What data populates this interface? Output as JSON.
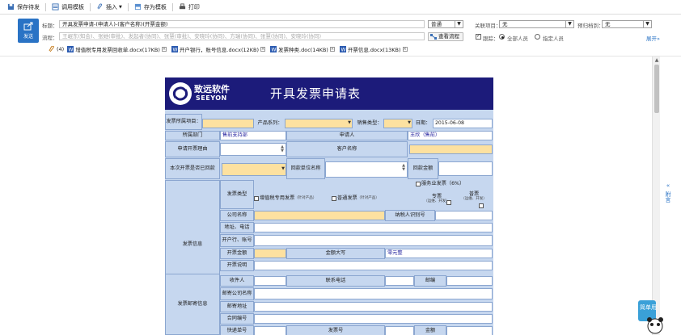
{
  "toolbar": {
    "save_pending": "保存待发",
    "use_template": "调用模板",
    "insert": "插入",
    "save_template": "存为模板",
    "print": "打印"
  },
  "header": {
    "send_label": "发送",
    "subject_label": "标题：",
    "subject_value": "开具发票申请-(申请人)-(客户名称)(开票金额)",
    "importance_value": "普通",
    "related_project_label": "关联项目：",
    "related_project_value": "无",
    "due_remind_label": "预归档到：",
    "due_remind_value": "无",
    "flow_label": "流程：",
    "flow_value": "王岷东(知会)、张她(审批)、发起者(协同)、张慧(审批)、安晓玲(协同)、方瑞(协同)、张慧(协同)、安晓玲(协同)",
    "view_flow": "查看流程",
    "trace_label": "跟踪：",
    "all_people": "全部人员",
    "specified_people": "指定人员",
    "expand": "展开"
  },
  "attachments": {
    "count": "(4)",
    "items": [
      "增值税专用发票回收单.docx(17KB)",
      "开户银行，账号信息.docx(12KB)",
      "发票种类.doc(14KB)",
      "开票信息.docx(13KB)"
    ]
  },
  "side_panel": {
    "label": "附言"
  },
  "mascot": {
    "text": "简单用"
  },
  "form": {
    "logo_cn": "致远软件",
    "logo_en": "SEEYON",
    "title": "开具发票申请表",
    "invoice_item": "发票所属项目：",
    "product_series": "产品系列：",
    "sales_type": "销售类型：",
    "date_label": "日期：",
    "date_value": "2015-06-08",
    "dept_label": "所属部门",
    "dept_value": "售前支持部",
    "applicant_label": "申请人",
    "applicant_value": "王欣（售前）",
    "reason_label": "申请开票理由",
    "customer_label": "客户名称",
    "is_return_label": "本次开票是否已回款",
    "payer_label": "回款单位名称",
    "return_amount_label": "回款金额",
    "service_invoice": "服务业发票（6%）",
    "invoice_type_label": "发票类型",
    "vat_special": "增值税专用发票",
    "vat_special_note": "（针对产品）",
    "vat_normal": "普通发票",
    "vat_normal_note": "（针对产品）",
    "special_label": "专票",
    "special_note": "（运维、开发）",
    "normal_label": "普票",
    "normal_note": "（运维、开发）",
    "invoice_info_label": "发票信息",
    "company_name": "公司名称",
    "taxpayer_id": "纳税人识别号",
    "address_phone": "地址、电话",
    "bank_account": "开户行、账号",
    "invoice_amount": "开票金额",
    "amount_caps": "金额大写",
    "amount_caps_value": "零元整",
    "invoice_note": "开票说明",
    "mail_info_label": "发票邮寄信息",
    "recipient": "收件人",
    "contact_phone": "联系电话",
    "postcode": "邮编",
    "mail_company": "邮寄公司名称",
    "mail_address": "邮寄地址",
    "contract_no": "合同编号",
    "express_no": "快递单号",
    "invoice_no": "发票号",
    "amount_label": "金额"
  }
}
